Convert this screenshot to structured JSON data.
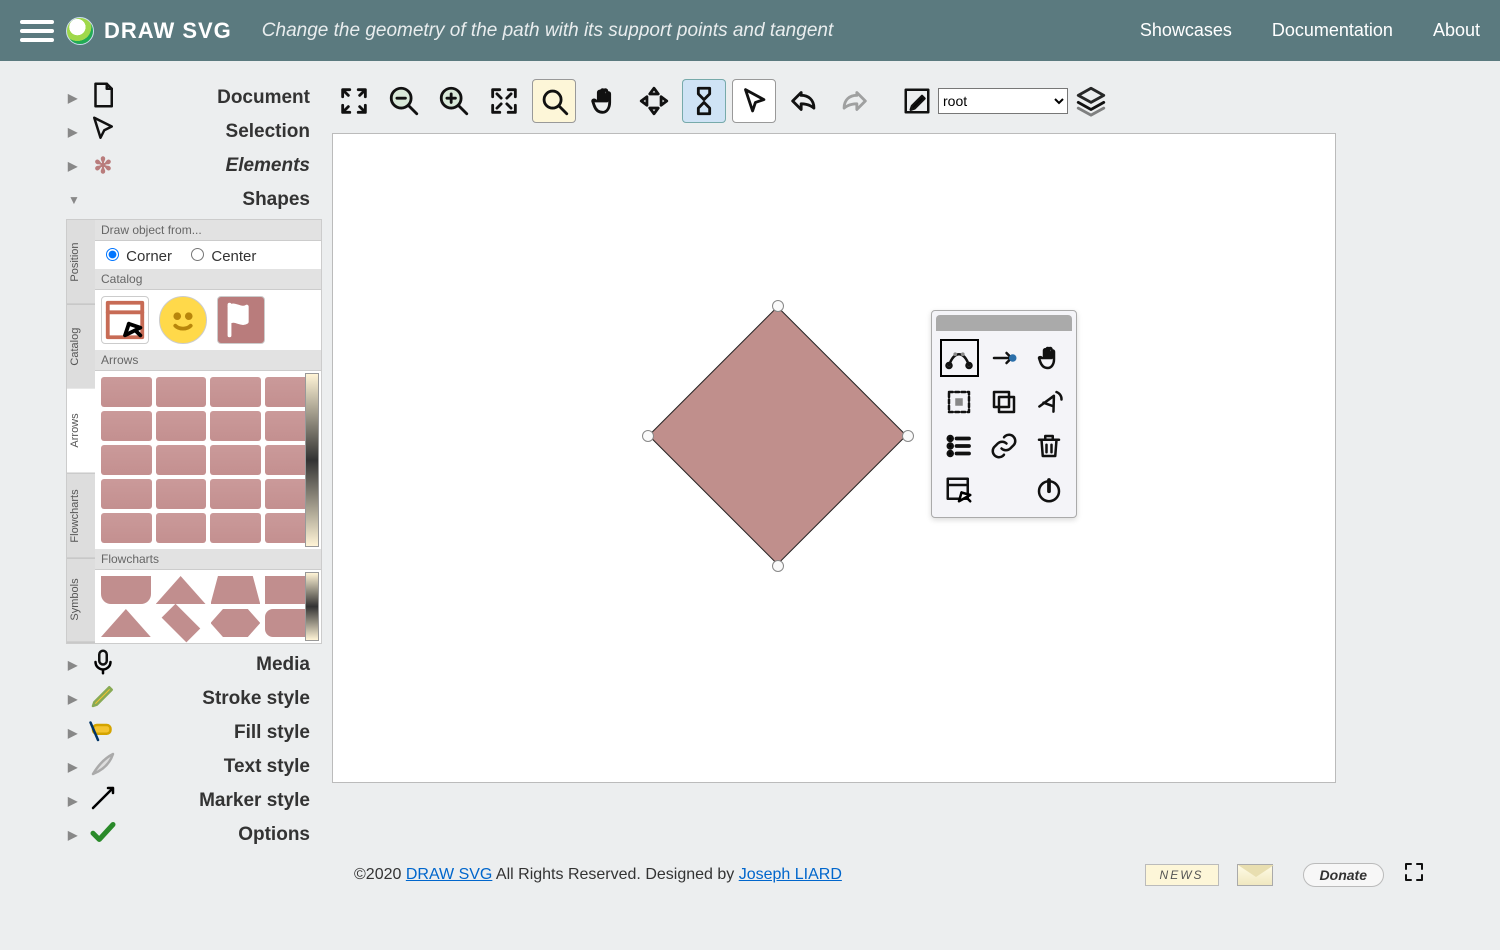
{
  "header": {
    "brand": "DRAW SVG",
    "hint": "Change the geometry of the path with its support points and tangent",
    "nav": {
      "showcases": "Showcases",
      "documentation": "Documentation",
      "about": "About"
    }
  },
  "sidebar": {
    "document": "Document",
    "selection": "Selection",
    "elements": "Elements",
    "shapes": "Shapes",
    "media": "Media",
    "stroke": "Stroke style",
    "fill": "Fill style",
    "text": "Text style",
    "marker": "Marker style",
    "options": "Options"
  },
  "shapes_panel": {
    "vtabs": {
      "position": "Position",
      "catalog": "Catalog",
      "arrows": "Arrows",
      "flowcharts": "Flowcharts",
      "symbols": "Symbols"
    },
    "draw_from": "Draw object from...",
    "corner": "Corner",
    "center": "Center",
    "catalog": "Catalog",
    "arrows": "Arrows",
    "flowcharts": "Flowcharts"
  },
  "toolbar": {
    "root_select": "root"
  },
  "footer": {
    "copyright_prefix": "©2020 ",
    "link1": "DRAW SVG",
    "mid": " All Rights Reserved. Designed by ",
    "link2": "Joseph LIARD",
    "news": "NEWS",
    "donate": "Donate"
  }
}
